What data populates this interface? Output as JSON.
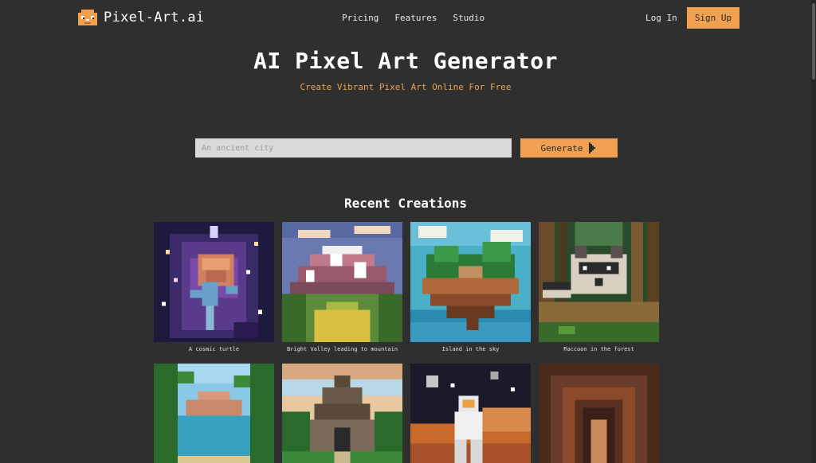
{
  "header": {
    "logo_text": "Pixel-Art.ai",
    "nav": [
      "Pricing",
      "Features",
      "Studio"
    ],
    "login_label": "Log In",
    "signup_label": "Sign Up"
  },
  "hero": {
    "title": "AI Pixel Art Generator",
    "subtitle": "Create Vibrant Pixel Art Online For Free"
  },
  "prompt": {
    "placeholder": "An ancient city",
    "generate_label": "Generate"
  },
  "recent": {
    "title": "Recent Creations",
    "items": [
      {
        "caption": "A cosmic turtle"
      },
      {
        "caption": "Bright Valley leading to mountain"
      },
      {
        "caption": "Island in the sky"
      },
      {
        "caption": "Raccoon in the forest"
      },
      {
        "caption": ""
      },
      {
        "caption": ""
      },
      {
        "caption": ""
      },
      {
        "caption": ""
      }
    ]
  },
  "colors": {
    "background": "#2f2f2f",
    "accent": "#f0a050",
    "input_bg": "#d9d9d9"
  }
}
